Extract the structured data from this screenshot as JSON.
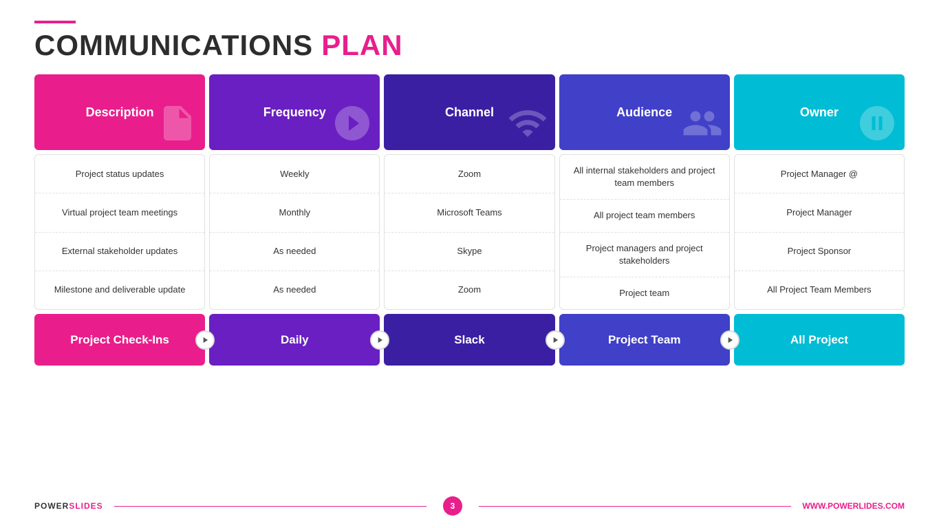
{
  "title": {
    "accent_line": true,
    "part1": "COMMUNICATIONS",
    "part2": "PLAN"
  },
  "columns": [
    {
      "id": "description",
      "label": "Description",
      "icon": "📌",
      "colorClass": "col-description"
    },
    {
      "id": "frequency",
      "label": "Frequency",
      "icon": "⚙️",
      "colorClass": "col-frequency"
    },
    {
      "id": "channel",
      "label": "Channel",
      "icon": "📡",
      "colorClass": "col-channel"
    },
    {
      "id": "audience",
      "label": "Audience",
      "icon": "🍸",
      "colorClass": "col-audience"
    },
    {
      "id": "owner",
      "label": "Owner",
      "icon": "🚀",
      "colorClass": "col-owner"
    }
  ],
  "rows": [
    [
      "Project status updates",
      "Weekly",
      "Zoom",
      "All internal stakeholders and project team members",
      "Project Manager @"
    ],
    [
      "Virtual project team meetings",
      "Monthly",
      "Microsoft Teams",
      "All project team members",
      "Project Manager"
    ],
    [
      "External stakeholder updates",
      "As needed",
      "Skype",
      "Project managers and project stakeholders",
      "Project Sponsor"
    ],
    [
      "Milestone and deliverable update",
      "As needed",
      "Zoom",
      "Project team",
      "All Project Team Members"
    ]
  ],
  "bottom_row": [
    {
      "label": "Project Check-Ins",
      "colorClass": "bottom-desc"
    },
    {
      "label": "Daily",
      "colorClass": "bottom-freq"
    },
    {
      "label": "Slack",
      "colorClass": "bottom-chan"
    },
    {
      "label": "Project Team",
      "colorClass": "bottom-aud"
    },
    {
      "label": "All Project",
      "colorClass": "bottom-own"
    }
  ],
  "footer": {
    "brand_bold": "POWER",
    "brand_rest": "SLIDES",
    "page_number": "3",
    "url": "WWW.POWERLIDES.COM"
  }
}
